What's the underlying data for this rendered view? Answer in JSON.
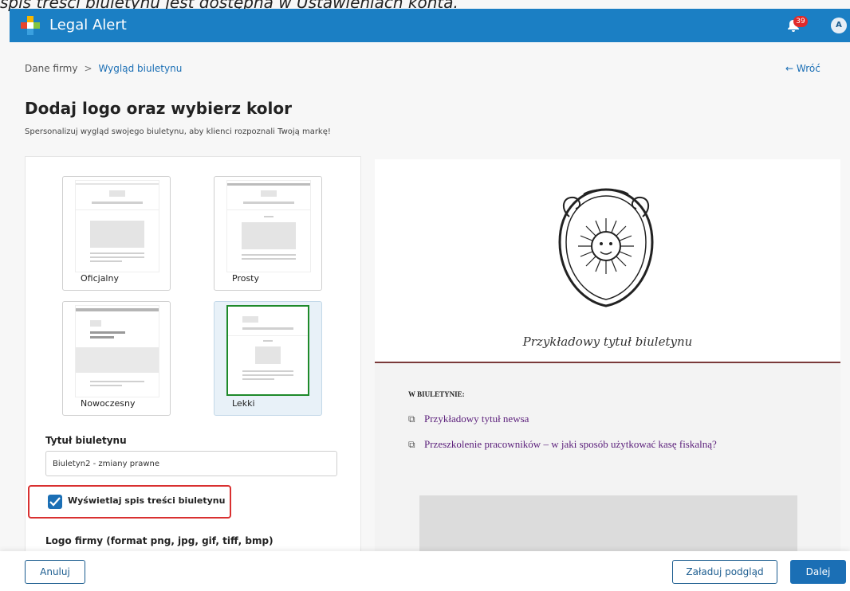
{
  "caption": "spis treści biuletynu jest dostępna w Ustawieniach konta.",
  "header": {
    "app_name": "Legal Alert",
    "notification_count": "39",
    "avatar_initials": "A"
  },
  "breadcrumb": {
    "items": [
      "Dane firmy",
      "Wygląd biuletynu"
    ],
    "separator": ">"
  },
  "back_link": "← Wróć",
  "page": {
    "title": "Dodaj logo oraz wybierz kolor",
    "subtitle": "Spersonalizuj wygląd swojego biuletynu, aby klienci rozpoznali Twoją markę!"
  },
  "templates": [
    {
      "label": "Oficjalny",
      "selected": false
    },
    {
      "label": "Prosty",
      "selected": false
    },
    {
      "label": "Nowoczesny",
      "selected": false
    },
    {
      "label": "Lekki",
      "selected": true
    }
  ],
  "form": {
    "title_label": "Tytuł biuletynu",
    "title_value": "Biuletyn2 - zmiany prawne",
    "toc_checkbox_label": "Wyświetlaj spis treści biuletynu",
    "toc_checked": true,
    "logo_label": "Logo firmy (format png, jpg, gif, tiff, bmp)"
  },
  "preview": {
    "newsletter_title": "Przykładowy tytuł biuletynu",
    "section_heading": "W BIULETYNIE:",
    "items": [
      "Przykładowy tytuł newsa",
      "Przeszkolenie pracowników – w jaki sposób użytkować kasę fiskalną?"
    ],
    "accent_color": "#7a3a3a",
    "link_color": "#5a1e7a"
  },
  "footer": {
    "cancel_label": "Anuluj",
    "load_preview_label": "Załaduj podgląd",
    "next_label": "Dalej"
  },
  "colors": {
    "brand_blue": "#1b7fc4",
    "selected_template_border": "#1e8a2a",
    "highlight_red": "#d93030"
  },
  "icons": [
    "logo-icon",
    "bell-icon",
    "checkmark-icon",
    "copy-icon",
    "crest-logo"
  ]
}
